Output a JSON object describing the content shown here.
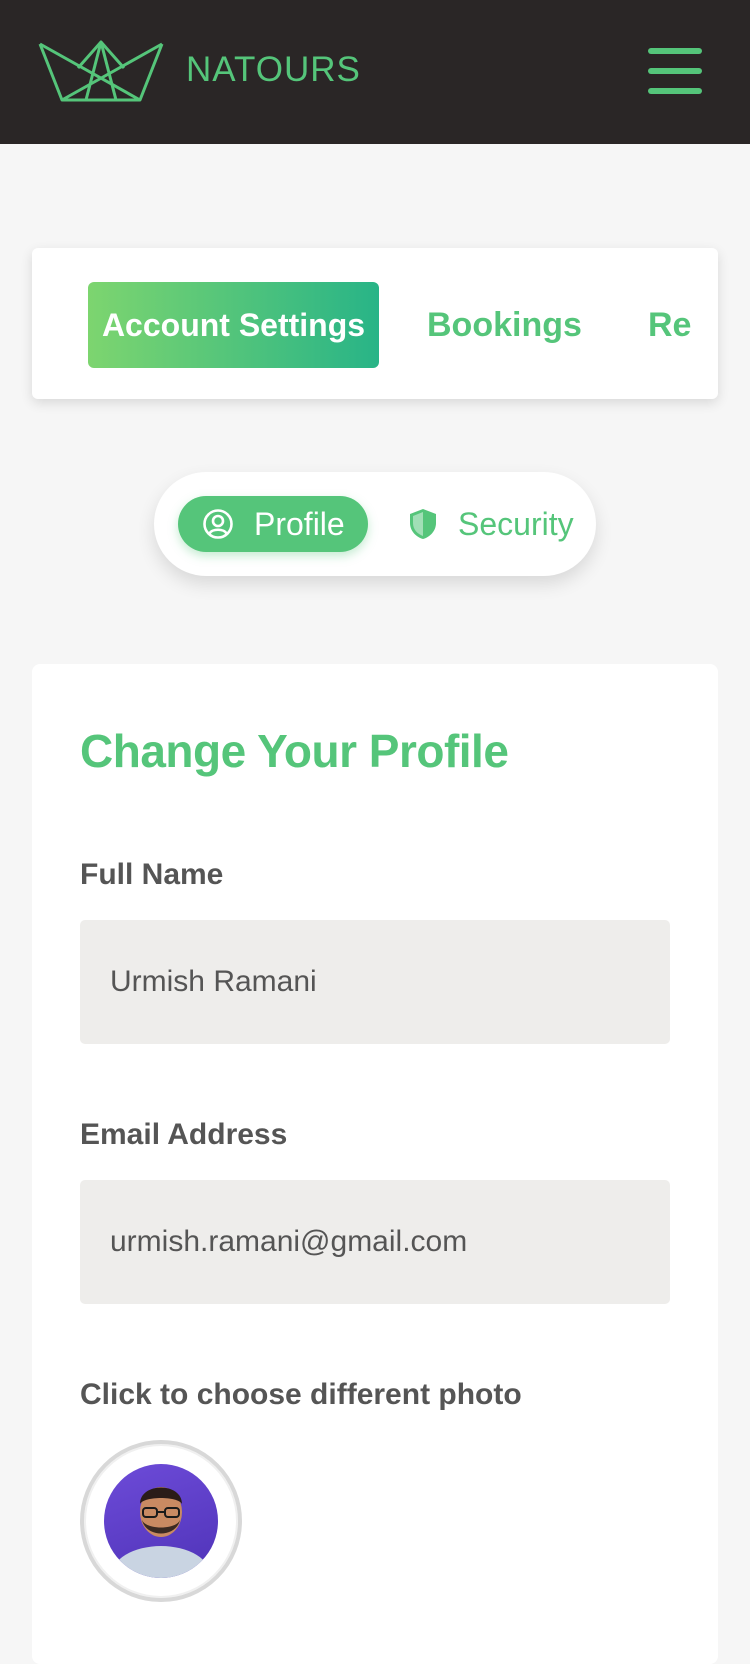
{
  "header": {
    "brand": "NATOURS",
    "logo_icon": "crown-logo-icon",
    "menu_icon": "hamburger-menu-icon"
  },
  "tabs": {
    "items": [
      {
        "label": "Account Settings",
        "active": true
      },
      {
        "label": "Bookings",
        "active": false
      },
      {
        "label": "Re",
        "active": false
      }
    ]
  },
  "subnav": {
    "profile_label": "Profile",
    "profile_icon": "user-circle-icon",
    "security_label": "Security",
    "security_icon": "shield-icon"
  },
  "form": {
    "heading": "Change Your Profile",
    "name_label": "Full Name",
    "name_value": "Urmish Ramani",
    "email_label": "Email Address",
    "email_value": "urmish.ramani@gmail.com",
    "photo_label": "Click to choose different photo"
  },
  "colors": {
    "accent": "#55c57a",
    "header_bg": "#2a2626",
    "page_bg": "#f6f6f6",
    "input_bg": "#eeedeb"
  }
}
